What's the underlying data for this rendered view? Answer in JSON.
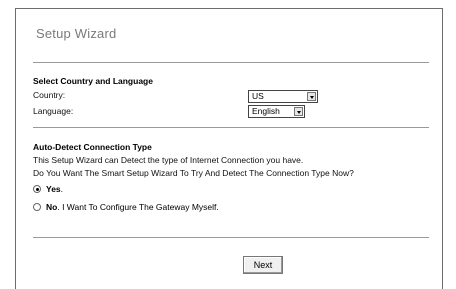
{
  "wizard": {
    "title": "Setup Wizard"
  },
  "country_language": {
    "heading": "Select Country and Language",
    "country_label": "Country:",
    "country_value": "US",
    "language_label": "Language:",
    "language_value": "English"
  },
  "autodetect": {
    "heading": "Auto-Detect Connection Type",
    "line1": "This Setup Wizard can Detect the type of Internet Connection you have.",
    "line2": "Do You Want The Smart Setup Wizard To Try And Detect The Connection Type Now?",
    "options": [
      {
        "bold": "Yes",
        "rest": ".",
        "checked": true
      },
      {
        "bold": "No",
        "rest": ". I Want To Configure The Gateway Myself.",
        "checked": false
      }
    ]
  },
  "actions": {
    "next_label": "Next"
  }
}
